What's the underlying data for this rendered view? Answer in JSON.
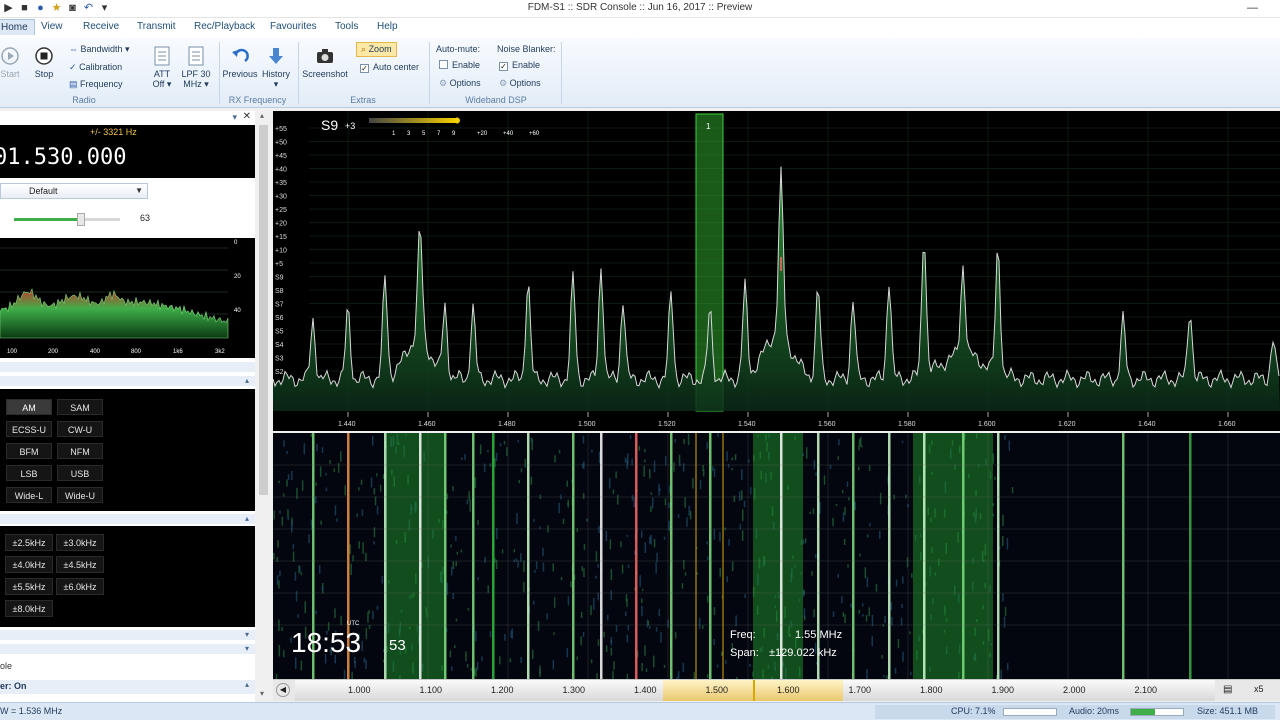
{
  "window": {
    "title": "FDM-S1 :: SDR Console :: Jun 16, 2017 :: Preview"
  },
  "menu": {
    "tabs": [
      "Home",
      "View",
      "Receive",
      "Transmit",
      "Rec/Playback",
      "Favourites",
      "Tools",
      "Help"
    ],
    "active": "Home"
  },
  "ribbon": {
    "start": "Start",
    "stop": "Stop",
    "bandwidth": "Bandwidth",
    "calibration": "Calibration",
    "frequency": "Frequency",
    "att_line1": "ATT",
    "att_line2": "Off",
    "lpf_line1": "LPF 30",
    "lpf_line2": "MHz",
    "group_radio": "Radio",
    "previous": "Previous",
    "history": "History",
    "group_rx_frequency": "RX Frequency",
    "screenshot": "Screenshot",
    "zoom": "Zoom",
    "auto_center": "Auto center",
    "group_extras": "Extras",
    "auto_mute": "Auto-mute:",
    "am_enable": "Enable",
    "am_options": "Options",
    "noise_blanker": "Noise Blanker:",
    "nb_enable": "Enable",
    "nb_options": "Options",
    "group_wideband": "Wideband DSP"
  },
  "left": {
    "offset": "+/- 3321 Hz",
    "frequency": "01.530.000",
    "preset": "Default",
    "volume": "63",
    "volume_level": 0.63,
    "audio_axis_right": [
      "0",
      "20",
      "40"
    ],
    "audio_axis_bottom": [
      "100",
      "200",
      "400",
      "800",
      "1k6",
      "3k2"
    ],
    "modes": [
      "AM",
      "SAM",
      "ECSS-U",
      "CW-U",
      "BFM",
      "NFM",
      "LSB",
      "USB",
      "Wide-L",
      "Wide-U"
    ],
    "mode_selected": "AM",
    "bandwidths": [
      "±2.5kHz",
      "±3.0kHz",
      "±4.0kHz",
      "±4.5kHz",
      "±5.5kHz",
      "±6.0kHz",
      "±8.0kHz"
    ],
    "footer_text": "ole",
    "footer_status": "er: On"
  },
  "spectrum": {
    "s_meter_label": "S9",
    "s_meter_plus": "+3",
    "s_scale": [
      "1",
      "3",
      "5",
      "7",
      "9",
      "+20",
      "+40",
      "+60"
    ],
    "db_scale": [
      "+55",
      "+50",
      "+45",
      "+40",
      "+35",
      "+30",
      "+25",
      "+20",
      "+15",
      "+10",
      "+5",
      "S9",
      "S8",
      "S7",
      "S6",
      "S5",
      "S4",
      "S3",
      "S2"
    ],
    "freq_axis": [
      "1.440",
      "1.460",
      "1.480",
      "1.500",
      "1.520",
      "1.540",
      "1.560",
      "1.580",
      "1.600",
      "1.620",
      "1.640",
      "1.660"
    ],
    "marker_label": "1",
    "colors": {
      "trace": "#d8d8d8",
      "fill": "#1e7a20",
      "marker": "#2fa52f"
    }
  },
  "waterfall": {
    "time_main": "18:53",
    "time_seconds": "53",
    "time_zone": "UTC",
    "freq_label": "Freq:",
    "freq_value": "1.55 MHz",
    "span_label": "Span:",
    "span_value": "±129.022 kHz"
  },
  "scroll": {
    "axis": [
      "1.000",
      "1.100",
      "1.200",
      "1.300",
      "1.400",
      "1.500",
      "1.600",
      "1.700",
      "1.800",
      "1.900",
      "2.000",
      "2.100"
    ],
    "zoom_label": "x5"
  },
  "status": {
    "left": "W = 1.536 MHz",
    "cpu": "CPU: 7.1%",
    "audio": "Audio: 20ms",
    "size": "Size: 451.1 MB"
  }
}
